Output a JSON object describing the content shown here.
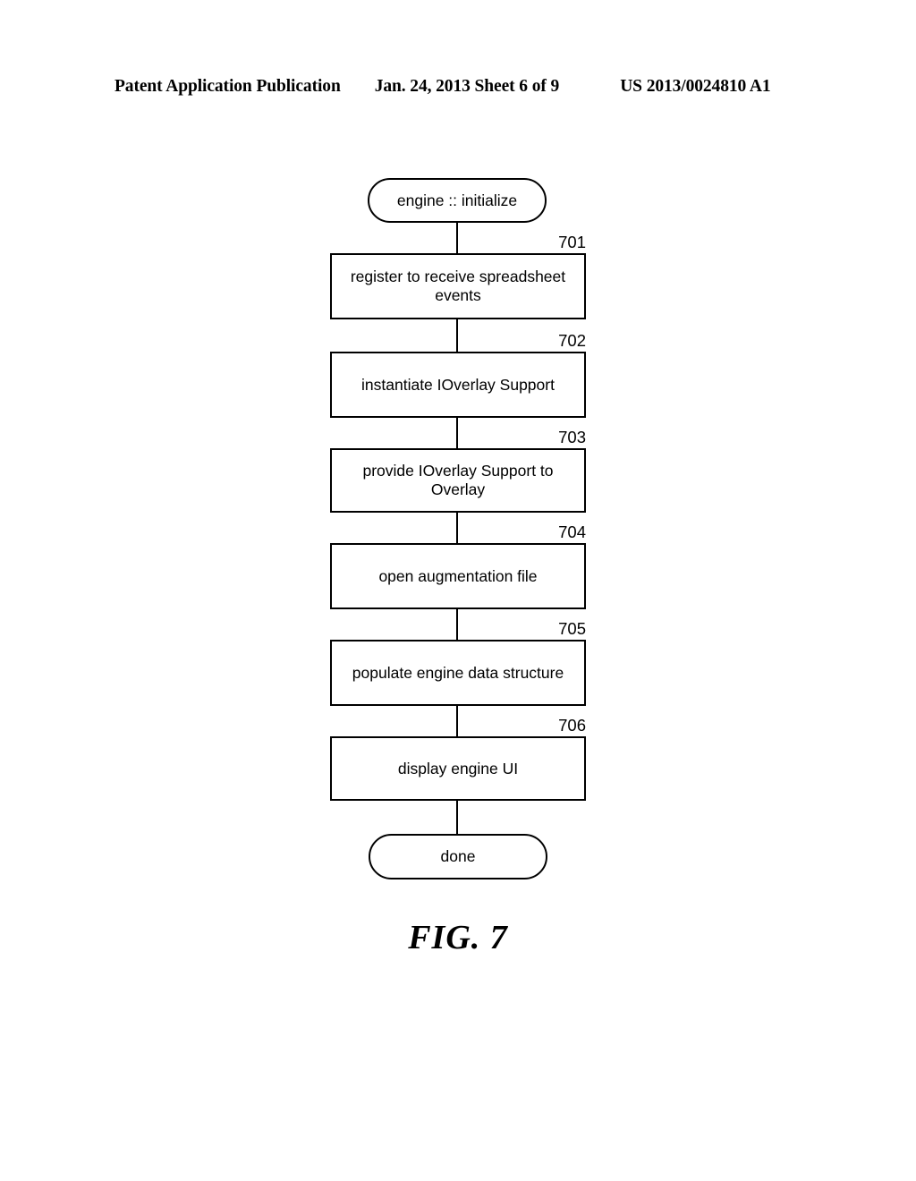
{
  "header": {
    "left": "Patent Application Publication",
    "middle": "Jan. 24, 2013  Sheet 6 of 9",
    "right": "US 2013/0024810 A1"
  },
  "figure": {
    "caption": "FIG. 7",
    "line_color": "#000000",
    "background": "#ffffff"
  },
  "flowchart": {
    "start": {
      "label": "engine :: initialize",
      "shape": "terminal"
    },
    "steps": [
      {
        "ref": "701",
        "label": "register to receive spreadsheet\nevents",
        "shape": "process"
      },
      {
        "ref": "702",
        "label": "instantiate IOverlay Support",
        "shape": "process"
      },
      {
        "ref": "703",
        "label": "provide IOverlay Support to\nOverlay",
        "shape": "process"
      },
      {
        "ref": "704",
        "label": "open augmentation file",
        "shape": "process"
      },
      {
        "ref": "705",
        "label": "populate engine data structure",
        "shape": "process"
      },
      {
        "ref": "706",
        "label": "display engine UI",
        "shape": "process"
      }
    ],
    "end": {
      "label": "done",
      "shape": "terminal"
    }
  }
}
